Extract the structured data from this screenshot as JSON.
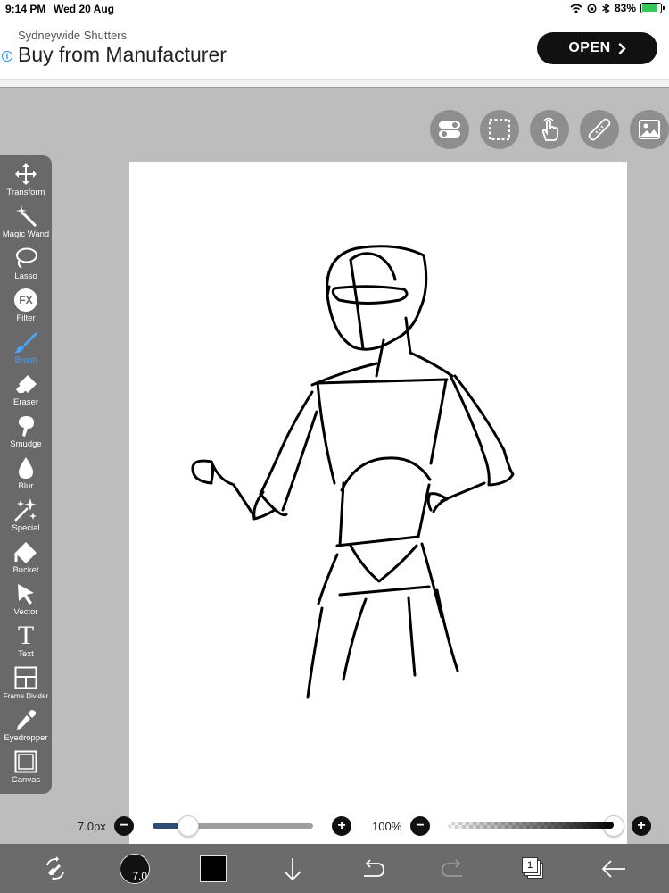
{
  "status_bar": {
    "time": "9:14 PM",
    "date": "Wed 20 Aug",
    "battery": "83%"
  },
  "ad": {
    "advertiser": "Sydneywide Shutters",
    "headline": "Buy from Manufacturer",
    "open_label": "OPEN",
    "info_glyph": "i"
  },
  "top_tools": [
    "toggle-icon",
    "selection-icon",
    "hand-gesture-icon",
    "ruler-icon",
    "image-icon"
  ],
  "toolbar": {
    "active": "Brush",
    "items": [
      {
        "label": "Transform",
        "icon": "move-arrows-icon"
      },
      {
        "label": "Magic Wand",
        "icon": "magic-wand-icon"
      },
      {
        "label": "Lasso",
        "icon": "lasso-icon"
      },
      {
        "label": "Filter",
        "icon": "fx-icon",
        "glyph": "FX"
      },
      {
        "label": "Brush",
        "icon": "brush-icon"
      },
      {
        "label": "Eraser",
        "icon": "eraser-icon"
      },
      {
        "label": "Smudge",
        "icon": "smudge-icon"
      },
      {
        "label": "Blur",
        "icon": "drop-icon"
      },
      {
        "label": "Special",
        "icon": "sparkle-icon"
      },
      {
        "label": "Bucket",
        "icon": "bucket-icon"
      },
      {
        "label": "Vector",
        "icon": "cursor-arrow-icon"
      },
      {
        "label": "Text",
        "icon": "text-icon",
        "glyph": "T"
      },
      {
        "label": "Frame Divider",
        "icon": "frame-divider-icon"
      },
      {
        "label": "Eyedropper",
        "icon": "eyedropper-icon"
      },
      {
        "label": "Canvas",
        "icon": "canvas-icon"
      }
    ]
  },
  "brush": {
    "size_label": "7.0px",
    "size_fraction": 0.22,
    "indicator": "7.0",
    "color": "#000000"
  },
  "opacity": {
    "label": "100%",
    "fraction": 1.0
  },
  "buttons": {
    "minus": "−",
    "plus": "+"
  },
  "bottom_bar": {
    "layer_count": "1"
  },
  "colors": {
    "accent": "#4aa3ff",
    "toolbar": "#696969",
    "canvas": "#ffffff",
    "background": "#bdbdbd"
  }
}
